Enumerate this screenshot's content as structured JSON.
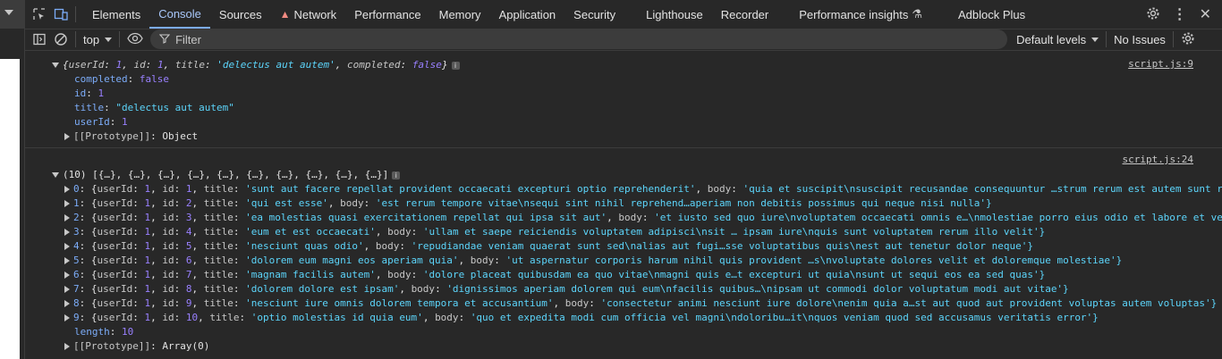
{
  "tabs": [
    "Elements",
    "Console",
    "Sources",
    "Network",
    "Performance",
    "Memory",
    "Application",
    "Security",
    "Lighthouse",
    "Recorder",
    "Performance insights",
    "Adblock Plus"
  ],
  "active_tab": "Console",
  "filterbar": {
    "context": "top",
    "filter_placeholder": "Filter",
    "levels": "Default levels",
    "issues": "No Issues"
  },
  "messages": {
    "obj": {
      "source": "script.js:9",
      "summary": "{userId: 1, id: 1, title: 'delectus aut autem', completed: false}",
      "completed": "false",
      "id": "1",
      "title": "\"delectus aut autem\"",
      "userId": "1",
      "proto": "Object"
    },
    "arr": {
      "source": "script.js:24",
      "summary": "(10) [{…}, {…}, {…}, {…}, {…}, {…}, {…}, {…}, {…}, {…}]",
      "items": [
        {
          "idx": "0",
          "id": "1",
          "title": "'sunt aut facere repellat provident occaecati excepturi optio reprehenderit'",
          "body": "'quia et suscipit\\nsuscipit recusandae consequuntur …strum rerum est autem sunt rem eveniet architecto'}"
        },
        {
          "idx": "1",
          "id": "2",
          "title": "'qui est esse'",
          "body": "'est rerum tempore vitae\\nsequi sint nihil reprehend…aperiam non debitis possimus qui neque nisi nulla'}"
        },
        {
          "idx": "2",
          "id": "3",
          "title": "'ea molestias quasi exercitationem repellat qui ipsa sit aut'",
          "body": "'et iusto sed quo iure\\nvoluptatem occaecati omnis e…\\nmolestiae porro eius odio et labore et velit aut'}"
        },
        {
          "idx": "3",
          "id": "4",
          "title": "'eum et est occaecati'",
          "body": "'ullam et saepe reiciendis voluptatem adipisci\\nsit … ipsam iure\\nquis sunt voluptatem rerum illo velit'}"
        },
        {
          "idx": "4",
          "id": "5",
          "title": "'nesciunt quas odio'",
          "body": "'repudiandae veniam quaerat sunt sed\\nalias aut fugi…sse voluptatibus quis\\nest aut tenetur dolor neque'}"
        },
        {
          "idx": "5",
          "id": "6",
          "title": "'dolorem eum magni eos aperiam quia'",
          "body": "'ut aspernatur corporis harum nihil quis provident …s\\nvoluptate dolores velit et doloremque molestiae'}"
        },
        {
          "idx": "6",
          "id": "7",
          "title": "'magnam facilis autem'",
          "body": "'dolore placeat quibusdam ea quo vitae\\nmagni quis e…t excepturi ut quia\\nsunt ut sequi eos ea sed quas'}"
        },
        {
          "idx": "7",
          "id": "8",
          "title": "'dolorem dolore est ipsam'",
          "body": "'dignissimos aperiam dolorem qui eum\\nfacilis quibus…\\nipsam ut commodi dolor voluptatum modi aut vitae'}"
        },
        {
          "idx": "8",
          "id": "9",
          "title": "'nesciunt iure omnis dolorem tempora et accusantium'",
          "body": "'consectetur animi nesciunt iure dolore\\nenim quia a…st aut quod aut provident voluptas autem voluptas'}"
        },
        {
          "idx": "9",
          "id": "10",
          "title": "'optio molestias id quia eum'",
          "body": "'quo et expedita modi cum officia vel magni\\ndoloribu…it\\nquos veniam quod sed accusamus veritatis error'}"
        }
      ],
      "length": "10",
      "proto": "Array(0)"
    }
  }
}
